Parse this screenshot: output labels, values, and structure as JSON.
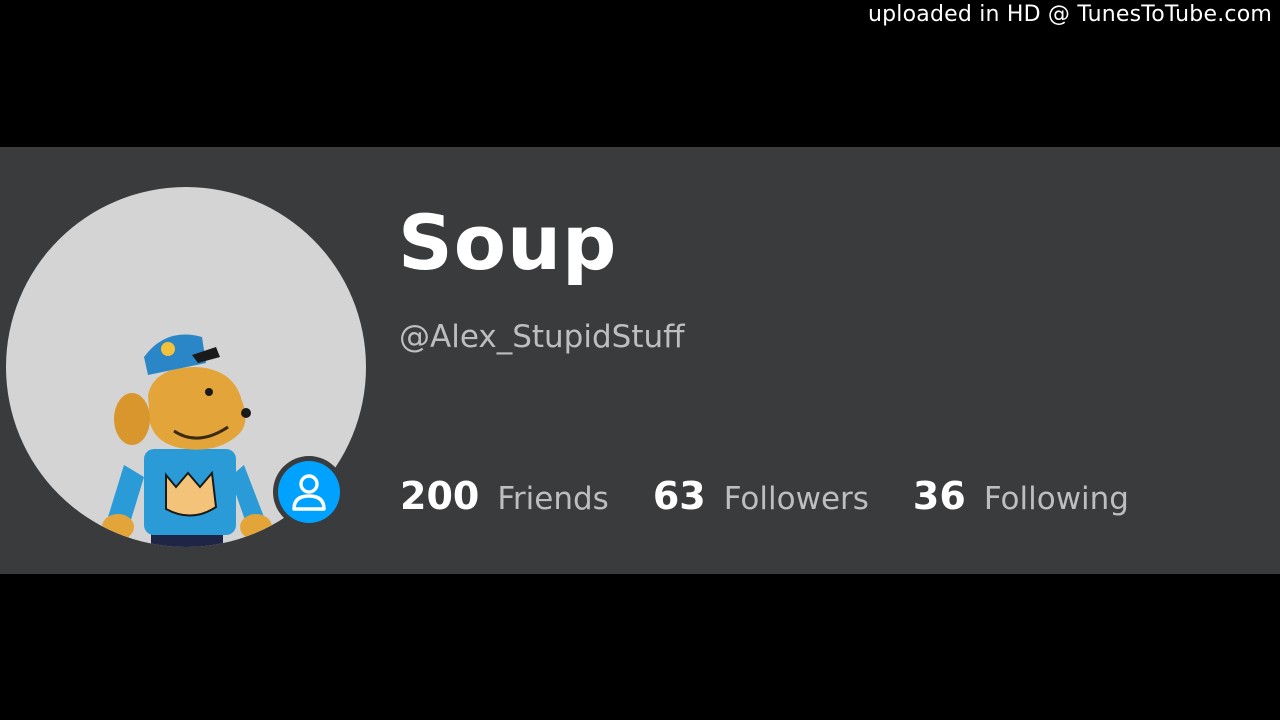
{
  "watermark": "uploaded in HD @ TunesToTube.com",
  "profile": {
    "display_name": "Soup",
    "username": "@Alex_StupidStuff",
    "avatar_icon": "roblox-avatar-dog-character",
    "presence_icon": "user-silhouette-icon",
    "stats": [
      {
        "count": "200",
        "label": "Friends"
      },
      {
        "count": "63",
        "label": "Followers"
      },
      {
        "count": "36",
        "label": "Following"
      }
    ]
  },
  "colors": {
    "background": "#000000",
    "card": "#393b3d",
    "avatar_bg": "#d4d4d4",
    "presence_badge": "#00a2ff",
    "text_primary": "#ffffff",
    "text_secondary": "#bdbebe"
  }
}
